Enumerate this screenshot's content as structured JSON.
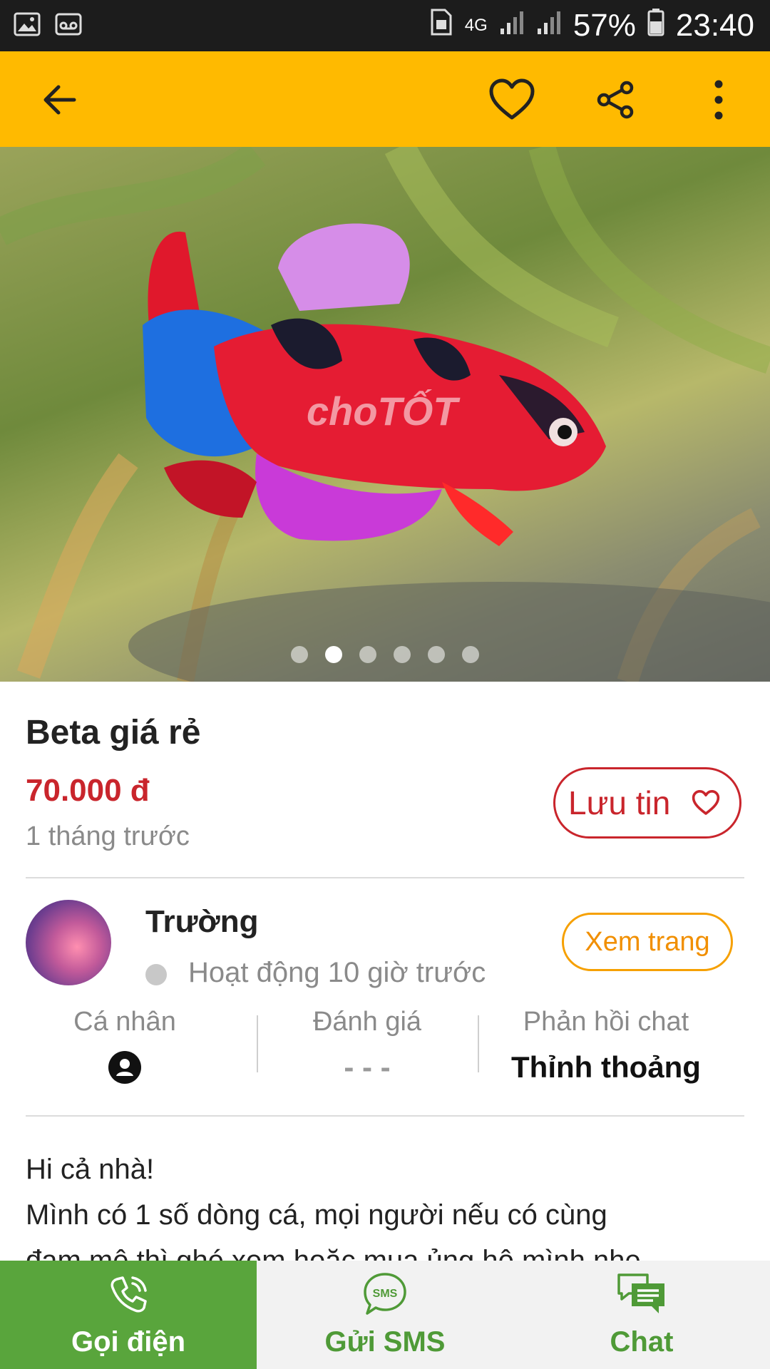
{
  "status_bar": {
    "network": "4G",
    "battery": "57%",
    "time": "23:40"
  },
  "toolbar": {
    "back_icon": "arrow-left-icon",
    "favorite_icon": "heart-outline-icon",
    "share_icon": "share-icon",
    "more_icon": "more-vertical-icon"
  },
  "gallery": {
    "watermark": "choTỐT",
    "current_index": 2,
    "total": 6
  },
  "listing": {
    "title": "Beta giá rẻ",
    "price": "70.000 đ",
    "posted": "1 tháng trước",
    "save_label": "Lưu tin"
  },
  "seller": {
    "name": "Trường",
    "activity": "Hoạt động 10 giờ trước",
    "view_page_label": "Xem trang",
    "stats": [
      {
        "label": "Cá nhân",
        "value": ""
      },
      {
        "label": "Đánh giá",
        "value": "- - -"
      },
      {
        "label": "Phản hồi chat",
        "value": "Thỉnh thoảng"
      }
    ]
  },
  "description": {
    "line1": "Hi cả nhà!",
    "line2": "Mình có 1 số dòng cá, mọi người nếu có cùng",
    "line3": "đam mê thì ghé xem hoặc mua ủng hộ mình nhe"
  },
  "bottom_bar": {
    "call_label": "Gọi điện",
    "sms_label": "Gửi SMS",
    "chat_label": "Chat"
  },
  "colors": {
    "toolbar": "#ffba00",
    "price": "#c9252c",
    "call_bg": "#59a53c",
    "accent_green": "#4f9a37",
    "view_btn": "#f6a000"
  }
}
